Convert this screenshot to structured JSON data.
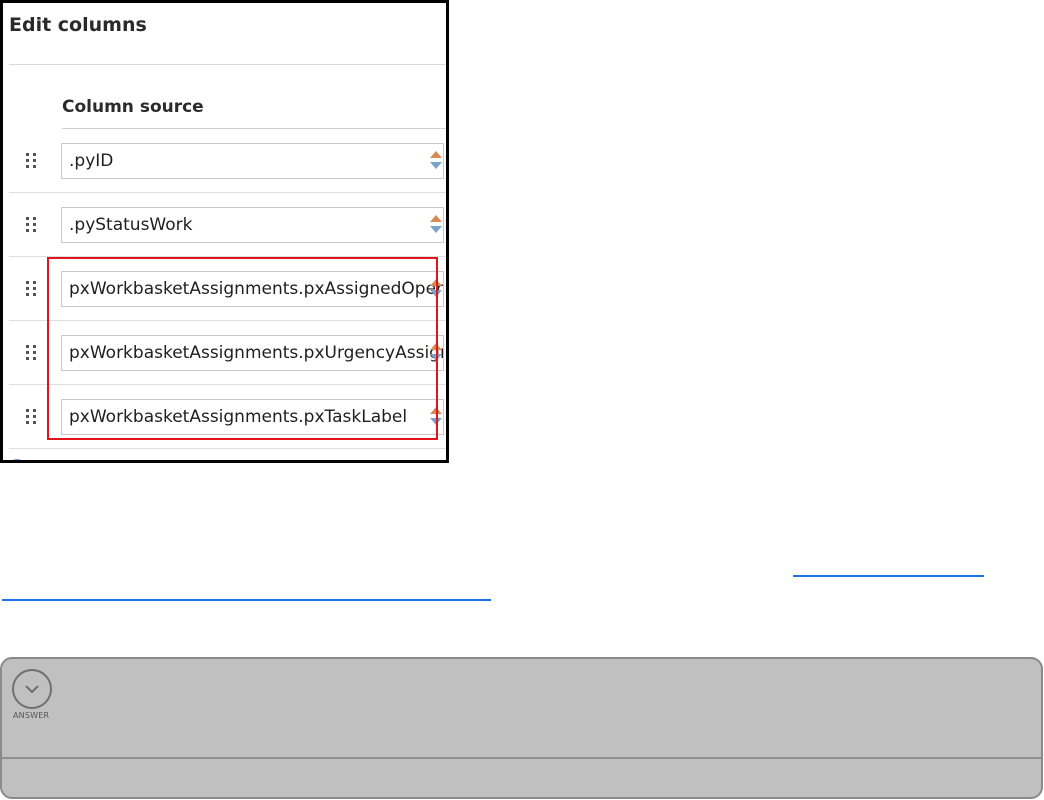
{
  "panel": {
    "title": "Edit columns",
    "column_header": "Column source",
    "rows": [
      {
        "value": ".pyID"
      },
      {
        "value": ".pyStatusWork"
      },
      {
        "value": "pxWorkbasketAssignments.pxAssignedOperatorID"
      },
      {
        "value": "pxWorkbasketAssignments.pxUrgencyAssign"
      },
      {
        "value": "pxWorkbasketAssignments.pxTaskLabel"
      }
    ]
  },
  "answer": {
    "label": "ANSWER"
  },
  "colors": {
    "highlight": "#e2141b",
    "link": "#1a73e8",
    "spinner_up": "#d88a55",
    "spinner_down": "#7ba3c9",
    "card_bg": "#c0c0c0"
  }
}
